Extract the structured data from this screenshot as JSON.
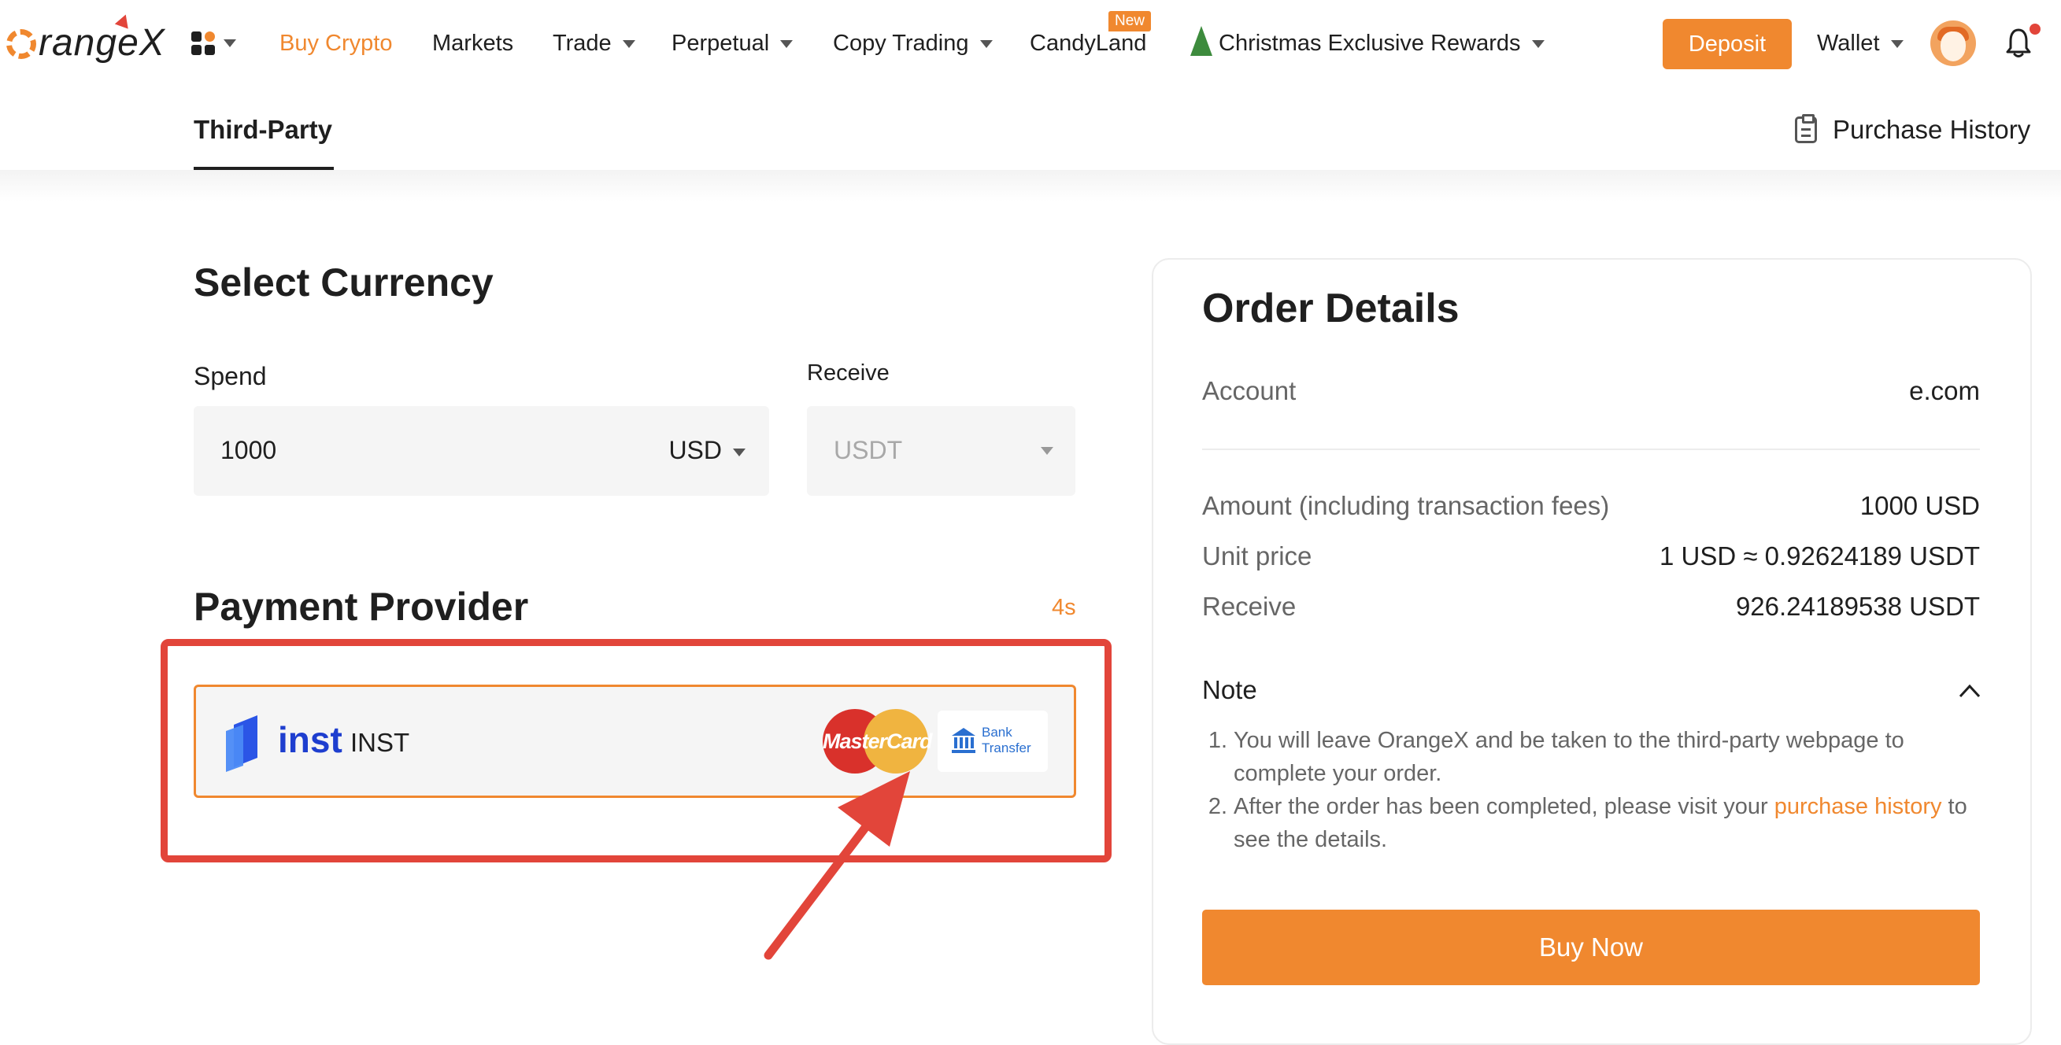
{
  "header": {
    "logo_text": "rangeX",
    "nav": [
      {
        "label": "Buy Crypto"
      },
      {
        "label": "Markets"
      },
      {
        "label": "Trade"
      },
      {
        "label": "Perpetual"
      },
      {
        "label": "Copy Trading"
      },
      {
        "label": "CandyLand",
        "badge": "New"
      },
      {
        "label": "Christmas Exclusive Rewards"
      }
    ],
    "deposit_label": "Deposit",
    "wallet_label": "Wallet",
    "accent_color": "#f0882f"
  },
  "subnav": {
    "tab_label": "Third-Party",
    "purchase_history_label": "Purchase History"
  },
  "select_currency": {
    "title": "Select Currency",
    "spend_label": "Spend",
    "spend_value": "1000",
    "spend_currency": "USD",
    "receive_label": "Receive",
    "receive_currency": "USDT"
  },
  "payment_provider": {
    "title": "Payment Provider",
    "timer": "4s",
    "provider_logo": "inst",
    "provider_name": "INST",
    "methods": {
      "card": "MasterCard",
      "bank_line1": "Bank",
      "bank_line2": "Transfer"
    }
  },
  "order_details": {
    "title": "Order Details",
    "account_label": "Account",
    "account_value": "e.com",
    "amount_label": "Amount (including transaction fees)",
    "amount_value": "1000 USD",
    "unit_price_label": "Unit price",
    "unit_price_value": "1 USD ≈ 0.92624189 USDT",
    "receive_label": "Receive",
    "receive_value": "926.24189538 USDT",
    "note_title": "Note",
    "notes": {
      "n1_num": "1.",
      "n1_text": "You will leave OrangeX and be taken to the third-party webpage to complete your order.",
      "n2_num": "2.",
      "n2_before": "After the order has been completed, please visit your ",
      "n2_link": "purchase history",
      "n2_after": " to see the details."
    },
    "buy_label": "Buy Now"
  }
}
